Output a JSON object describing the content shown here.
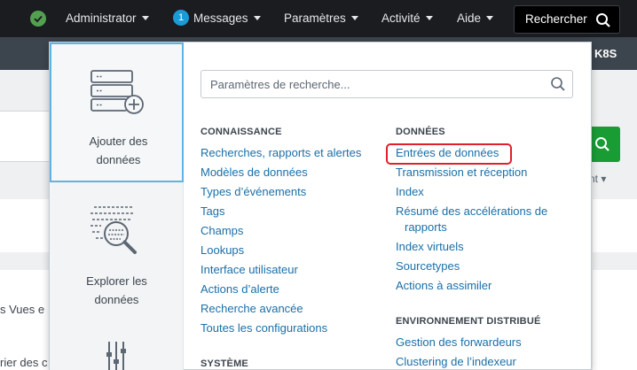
{
  "topnav": {
    "items": [
      {
        "label": "Administrator"
      },
      {
        "label": "Messages",
        "badge": "1"
      },
      {
        "label": "Paramètres"
      },
      {
        "label": "Activité"
      },
      {
        "label": "Aide"
      }
    ],
    "search_label": "Rechercher"
  },
  "appbar": {
    "label": "K8S"
  },
  "background": {
    "left_text_1": "s Vues e",
    "left_text_2": "rier des c",
    "right_text": "nt"
  },
  "dropdown": {
    "tiles": [
      {
        "label_line1": "Ajouter des",
        "label_line2": "données",
        "icon": "add-data-icon"
      },
      {
        "label_line1": "Explorer les",
        "label_line2": "données",
        "icon": "explore-data-icon"
      },
      {
        "icon": "sliders-icon"
      }
    ],
    "search_placeholder": "Paramètres de recherche...",
    "sections": {
      "connaissance": {
        "title": "CONNAISSANCE",
        "links": [
          "Recherches, rapports et alertes",
          "Modèles de données",
          "Types d’événements",
          "Tags",
          "Champs",
          "Lookups",
          "Interface utilisateur",
          "Actions d’alerte",
          "Recherche avancée",
          "Toutes les configurations"
        ]
      },
      "systeme": {
        "title": "SYSTÈME"
      },
      "donnees": {
        "title": "DONNÉES",
        "links": [
          "Entrées de données",
          "Transmission et réception",
          "Index",
          "Résumé des accélérations de",
          "rapports",
          "Index virtuels",
          "Sourcetypes",
          "Actions à assimiler"
        ]
      },
      "environnement": {
        "title": "ENVIRONNEMENT DISTRIBUÉ",
        "links": [
          "Gestion des forwardeurs",
          "Clustering de l’indexeur"
        ]
      }
    }
  },
  "colors": {
    "topbar": "#1a1c20",
    "appbar": "#3c444d",
    "link": "#1a6fa8",
    "highlight": "#e0202e",
    "status_ok": "#53a051",
    "badge": "#1a9ad6",
    "search_go": "#1a9c35"
  }
}
